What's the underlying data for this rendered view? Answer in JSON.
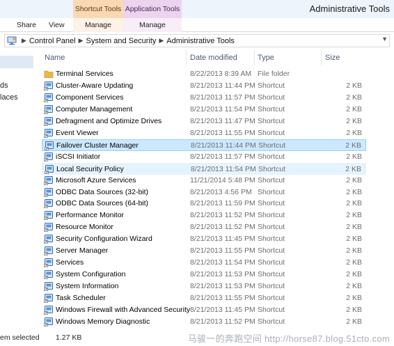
{
  "window": {
    "title": "Administrative Tools"
  },
  "contextual_tabs": {
    "shortcut_tools": "Shortcut Tools",
    "application_tools": "Application Tools"
  },
  "ribbon": {
    "share": "Share",
    "view": "View",
    "manage_shortcut": "Manage",
    "manage_application": "Manage"
  },
  "address": {
    "crumbs": [
      "Control Panel",
      "System and Security",
      "Administrative Tools"
    ]
  },
  "nav": {
    "items": [
      "ds",
      "laces"
    ]
  },
  "columns": {
    "name": "Name",
    "date": "Date modified",
    "type": "Type",
    "size": "Size"
  },
  "files": [
    {
      "name": "Terminal Services",
      "date": "8/22/2013 8:39 AM",
      "type": "File folder",
      "size": "",
      "icon": "folder-icon"
    },
    {
      "name": "Cluster-Aware Updating",
      "date": "8/21/2013 11:44 PM",
      "type": "Shortcut",
      "size": "2 KB",
      "icon": "cluster-update-icon"
    },
    {
      "name": "Component Services",
      "date": "8/21/2013 11:57 PM",
      "type": "Shortcut",
      "size": "2 KB",
      "icon": "component-services-icon"
    },
    {
      "name": "Computer Management",
      "date": "8/21/2013 11:54 PM",
      "type": "Shortcut",
      "size": "2 KB",
      "icon": "computer-management-icon"
    },
    {
      "name": "Defragment and Optimize Drives",
      "date": "8/21/2013 11:47 PM",
      "type": "Shortcut",
      "size": "2 KB",
      "icon": "defrag-icon"
    },
    {
      "name": "Event Viewer",
      "date": "8/21/2013 11:55 PM",
      "type": "Shortcut",
      "size": "2 KB",
      "icon": "event-viewer-icon"
    },
    {
      "name": "Failover Cluster Manager",
      "date": "8/21/2013 11:44 PM",
      "type": "Shortcut",
      "size": "2 KB",
      "icon": "failover-cluster-icon"
    },
    {
      "name": "iSCSI Initiator",
      "date": "8/21/2013 11:57 PM",
      "type": "Shortcut",
      "size": "2 KB",
      "icon": "iscsi-icon"
    },
    {
      "name": "Local Security Policy",
      "date": "8/21/2013 11:54 PM",
      "type": "Shortcut",
      "size": "2 KB",
      "icon": "security-policy-icon"
    },
    {
      "name": "Microsoft Azure Services",
      "date": "11/21/2014 5:48 PM",
      "type": "Shortcut",
      "size": "2 KB",
      "icon": "azure-icon"
    },
    {
      "name": "ODBC Data Sources (32-bit)",
      "date": "8/21/2013 4:56 PM",
      "type": "Shortcut",
      "size": "2 KB",
      "icon": "odbc-icon"
    },
    {
      "name": "ODBC Data Sources (64-bit)",
      "date": "8/21/2013 11:59 PM",
      "type": "Shortcut",
      "size": "2 KB",
      "icon": "odbc-icon"
    },
    {
      "name": "Performance Monitor",
      "date": "8/21/2013 11:52 PM",
      "type": "Shortcut",
      "size": "2 KB",
      "icon": "performance-monitor-icon"
    },
    {
      "name": "Resource Monitor",
      "date": "8/21/2013 11:52 PM",
      "type": "Shortcut",
      "size": "2 KB",
      "icon": "resource-monitor-icon"
    },
    {
      "name": "Security Configuration Wizard",
      "date": "8/21/2013 11:45 PM",
      "type": "Shortcut",
      "size": "2 KB",
      "icon": "security-wizard-icon"
    },
    {
      "name": "Server Manager",
      "date": "8/21/2013 11:55 PM",
      "type": "Shortcut",
      "size": "2 KB",
      "icon": "server-manager-icon"
    },
    {
      "name": "Services",
      "date": "8/21/2013 11:54 PM",
      "type": "Shortcut",
      "size": "2 KB",
      "icon": "services-icon"
    },
    {
      "name": "System Configuration",
      "date": "8/21/2013 11:53 PM",
      "type": "Shortcut",
      "size": "2 KB",
      "icon": "system-config-icon"
    },
    {
      "name": "System Information",
      "date": "8/21/2013 11:53 PM",
      "type": "Shortcut",
      "size": "2 KB",
      "icon": "system-info-icon"
    },
    {
      "name": "Task Scheduler",
      "date": "8/21/2013 11:55 PM",
      "type": "Shortcut",
      "size": "2 KB",
      "icon": "task-scheduler-icon"
    },
    {
      "name": "Windows Firewall with Advanced Security",
      "date": "8/21/2013 11:45 PM",
      "type": "Shortcut",
      "size": "2 KB",
      "icon": "firewall-icon"
    },
    {
      "name": "Windows Memory Diagnostic",
      "date": "8/21/2013 11:52 PM",
      "type": "Shortcut",
      "size": "2 KB",
      "icon": "memory-diagnostic-icon"
    }
  ],
  "selection": {
    "selected_name": "Failover Cluster Manager",
    "hovered_name": "Local Security Policy"
  },
  "status": {
    "text": "em selected",
    "size": "1.27 KB"
  },
  "watermark": "马骏一的奔跑空间 http://horse87.blog.51cto.com",
  "colors": {
    "folder": "#e8b84a",
    "shortcut_blue": "#2f6db5",
    "selected_row": "#cce8ff",
    "hover_row": "#e5f3ff"
  }
}
